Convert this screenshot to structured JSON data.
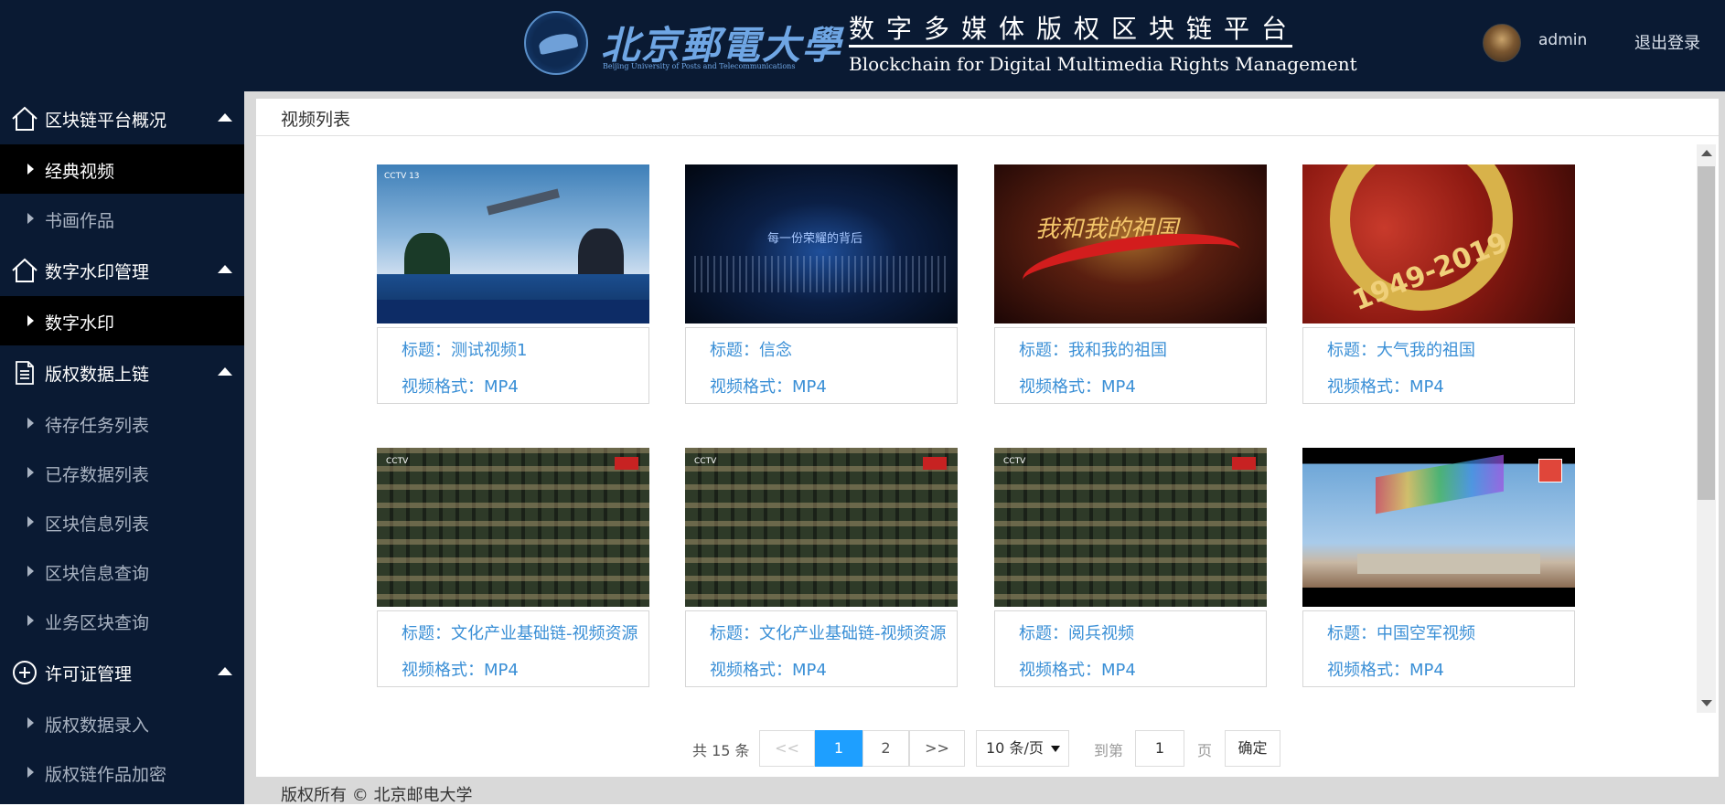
{
  "header": {
    "logo_cn": "北京郵電大學",
    "logo_en": "Beijing University of Posts and Telecommunications",
    "title_cn": "数字多媒体版权区块链平台",
    "title_en": "Blockchain for Digital Multimedia Rights Management",
    "username": "admin",
    "logout_label": "退出登录"
  },
  "sidebar": {
    "sections": [
      {
        "label": "区块链平台概况",
        "icon": "home-icon",
        "items": [
          {
            "label": "经典视频",
            "active": true
          },
          {
            "label": "书画作品",
            "active": false
          }
        ]
      },
      {
        "label": "数字水印管理",
        "icon": "home-icon",
        "items": [
          {
            "label": "数字水印",
            "active": true
          }
        ]
      },
      {
        "label": "版权数据上链",
        "icon": "document-icon",
        "items": [
          {
            "label": "待存任务列表",
            "active": false
          },
          {
            "label": "已存数据列表",
            "active": false
          },
          {
            "label": "区块信息列表",
            "active": false
          },
          {
            "label": "区块信息查询",
            "active": false
          },
          {
            "label": "业务区块查询",
            "active": false
          }
        ]
      },
      {
        "label": "许可证管理",
        "icon": "plus-circle-icon",
        "items": [
          {
            "label": "版权数据录入",
            "active": false
          },
          {
            "label": "版权链作品加密",
            "active": false
          }
        ]
      }
    ]
  },
  "panel": {
    "title": "视频列表"
  },
  "videos": [
    {
      "title": "标题：测试视频1",
      "format": "视频格式：MP4"
    },
    {
      "title": "标题：信念",
      "format": "视频格式：MP4"
    },
    {
      "title": "标题：我和我的祖国",
      "format": "视频格式：MP4"
    },
    {
      "title": "标题：大气我的祖国",
      "format": "视频格式：MP4"
    },
    {
      "title": "标题：文化产业基础链-视频资源",
      "format": "视频格式：MP4"
    },
    {
      "title": "标题：文化产业基础链-视频资源",
      "format": "视频格式：MP4"
    },
    {
      "title": "标题：阅兵视频",
      "format": "视频格式：MP4"
    },
    {
      "title": "标题：中国空军视频",
      "format": "视频格式：MP4"
    }
  ],
  "thumbs": {
    "news_caption": "CCTV 13",
    "glory_text": "每一份荣耀的背后",
    "red_text": "我和我的祖国",
    "gold_text": "1949-2019",
    "troops_cctv": "CCTV"
  },
  "pagination": {
    "total": "共 15 条",
    "prev": "<<",
    "pages": [
      "1",
      "2"
    ],
    "current_page": 1,
    "next": ">>",
    "page_size": "10 条/页",
    "goto_label": "到第",
    "goto_value": "1",
    "page_label": "页",
    "confirm": "确定"
  },
  "footer": {
    "copyright": "版权所有 © 北京邮电大学"
  },
  "colors": {
    "header_bg": "#0a1a33",
    "link_blue": "#3a8fd6",
    "active_page": "#1e9fff"
  }
}
